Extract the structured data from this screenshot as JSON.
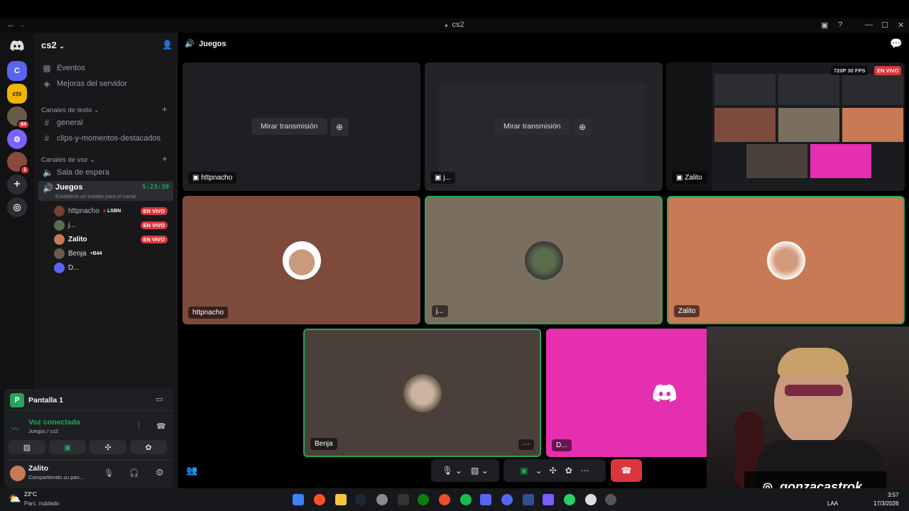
{
  "window": {
    "title": "cs2"
  },
  "sidebar": {
    "server_name": "cs2",
    "top_items": [
      {
        "label": "Eventos",
        "icon": "calendar-icon"
      },
      {
        "label": "Mejoras del servidor",
        "icon": "boost-icon"
      }
    ],
    "text_category": "Canales de texto",
    "text_channels": [
      "general",
      "clips-y-momentos-destacados"
    ],
    "voice_category": "Canales de voz",
    "voice_channels": [
      "Sala de espera",
      "Juegos"
    ],
    "active_channel": {
      "name": "Juegos",
      "timer": "5:23:39",
      "status_hint": "Establece un estado para el canal"
    },
    "members": [
      {
        "name": "httpnacho",
        "tag": "LSBN",
        "live": "EN VIVO",
        "color": "#7a3d2e"
      },
      {
        "name": "j...",
        "tag": "",
        "live": "EN VIVO",
        "color": "#5a6d4a"
      },
      {
        "name": "Zalito",
        "tag": "",
        "live": "EN VIVO",
        "color": "#c87a55"
      },
      {
        "name": "Benja",
        "tag": "B44",
        "live": "",
        "color": "#6a5b4a"
      },
      {
        "name": "D...",
        "tag": "",
        "live": "",
        "color": "#5865f2"
      }
    ]
  },
  "rail": {
    "servers": [
      {
        "label": "C",
        "color": "#5865f2",
        "badge": ""
      },
      {
        "label": "cts",
        "color": "#f0b400",
        "badge": ""
      },
      {
        "label": "",
        "color": "#6b5a48",
        "badge": "64"
      },
      {
        "label": "",
        "color": "#7b61ff",
        "badge": ""
      },
      {
        "label": "",
        "color": "#8a4a3a",
        "badge": "1"
      }
    ]
  },
  "panel": {
    "stream_title": "Pantalla 1",
    "voice_status": "Voz conectada",
    "voice_location": "Juegos / cs2",
    "user_name": "Zalito",
    "user_status": "Compartiendo su pan..."
  },
  "main": {
    "channel_title": "Juegos",
    "watch_label": "Mirar transmisión",
    "stream_overlay_badge": "720P 30 FPS",
    "stream_live": "EN VIVO",
    "tiles": [
      {
        "name": "httpnacho",
        "color": "#7d4a3c"
      },
      {
        "name": "j...",
        "color": "#7a6e5e"
      },
      {
        "name": "Zalito",
        "color": "#c87a55"
      },
      {
        "name": "Benja",
        "color": "#4a3f3a"
      },
      {
        "name": "D...",
        "color": "#e62eb1"
      }
    ],
    "streams": [
      {
        "name": "httpnacho"
      },
      {
        "name": "j..."
      },
      {
        "name": "Zalito"
      }
    ]
  },
  "taskbar": {
    "weather_temp": "23°C",
    "weather_desc": "Parc. nublado",
    "lang": "LAA",
    "time": "3:57",
    "date": "17/3/2026"
  },
  "overlay": {
    "instagram": "gonzacastrok"
  }
}
